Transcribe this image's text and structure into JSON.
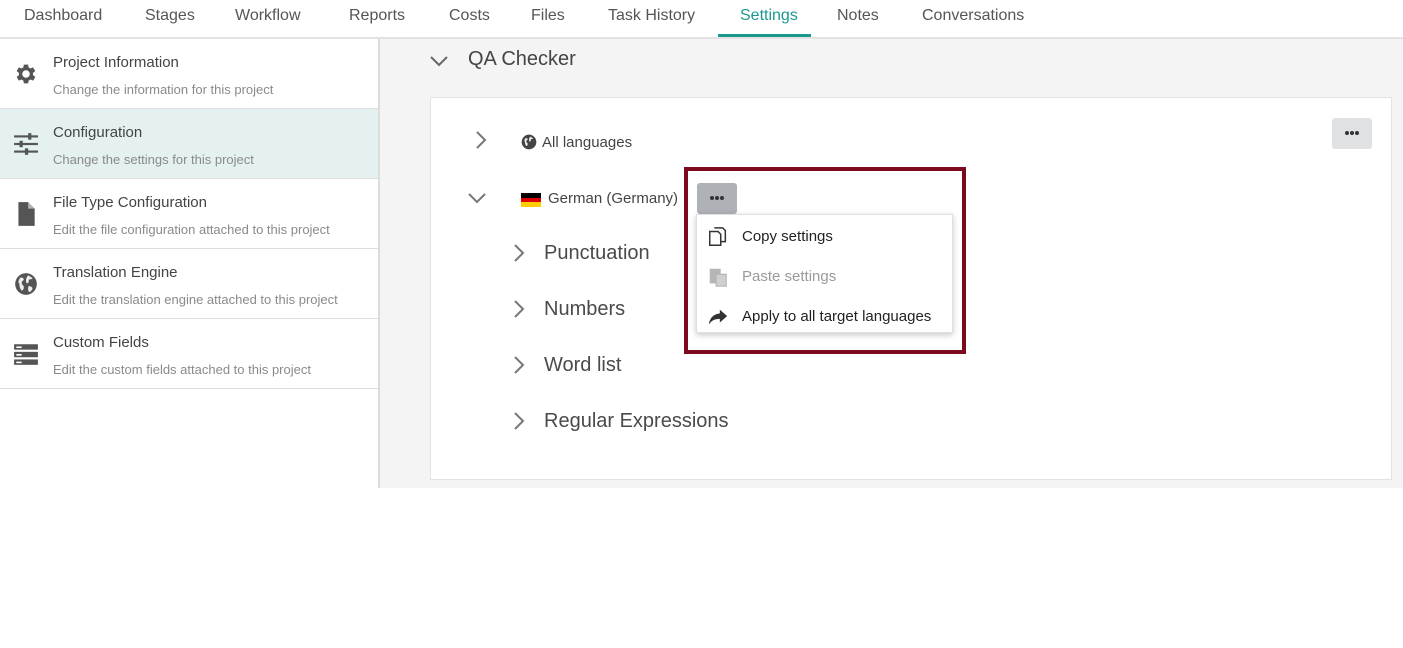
{
  "tabs": [
    {
      "label": "Dashboard",
      "active": false
    },
    {
      "label": "Stages",
      "active": false
    },
    {
      "label": "Workflow",
      "active": false
    },
    {
      "label": "Reports",
      "active": false
    },
    {
      "label": "Costs",
      "active": false
    },
    {
      "label": "Files",
      "active": false
    },
    {
      "label": "Task History",
      "active": false
    },
    {
      "label": "Settings",
      "active": true
    },
    {
      "label": "Notes",
      "active": false
    },
    {
      "label": "Conversations",
      "active": false
    }
  ],
  "sidebar": {
    "items": [
      {
        "icon": "gear-icon",
        "title": "Project Information",
        "desc": "Change the information for this project",
        "active": false
      },
      {
        "icon": "sliders-icon",
        "title": "Configuration",
        "desc": "Change the settings for this project",
        "active": true
      },
      {
        "icon": "file-icon",
        "title": "File Type Configuration",
        "desc": "Edit the file configuration attached to this project",
        "active": false
      },
      {
        "icon": "globe-icon",
        "title": "Translation Engine",
        "desc": "Edit the translation engine attached to this project",
        "active": false
      },
      {
        "icon": "server-icon",
        "title": "Custom Fields",
        "desc": "Edit the custom fields attached to this project",
        "active": false
      }
    ]
  },
  "main": {
    "section_title": "QA Checker",
    "languages": [
      {
        "label": "All languages",
        "icon": "globe-icon",
        "expanded": false
      },
      {
        "label": "German (Germany)",
        "icon": "german-flag-icon",
        "expanded": true
      }
    ],
    "subsections": [
      "Punctuation",
      "Numbers",
      "Word list",
      "Regular Expressions"
    ]
  },
  "context_menu": {
    "items": [
      {
        "icon": "copy-icon",
        "label": "Copy settings",
        "enabled": true
      },
      {
        "icon": "paste-icon",
        "label": "Paste settings",
        "enabled": false
      },
      {
        "icon": "share-arrow-icon",
        "label": "Apply to all target languages",
        "enabled": true
      }
    ]
  },
  "colors": {
    "accent": "#1a9a8f",
    "active_sidebar_bg": "#e4f1f0",
    "highlight_border": "#7a0a1c"
  }
}
